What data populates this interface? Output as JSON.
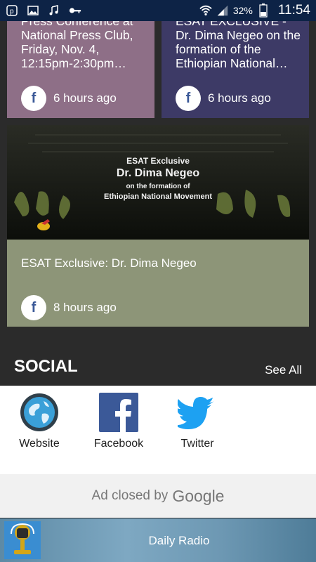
{
  "status_bar": {
    "battery_pct": "32%",
    "time": "11:54",
    "icons": [
      "p-app-icon",
      "image-icon",
      "music-note-icon",
      "key-icon",
      "wifi-icon",
      "signal-icon",
      "battery-icon"
    ]
  },
  "cards_top": [
    {
      "text": "Press Conference at National Press Club, Friday, Nov. 4, 12:15pm-2:30pm…",
      "time": "6 hours ago",
      "color": "#8e6f87"
    },
    {
      "text": "ESAT EXCLUSIVE - Dr. Dima Negeo on the formation of the Ethiopian National…",
      "time": "6 hours ago",
      "color": "#3d3a66"
    }
  ],
  "card_big": {
    "image_lines": [
      "ESAT Exclusive",
      "Dr. Dima Negeo",
      "on the formation of",
      "Ethiopian National Movement"
    ],
    "title": "ESAT Exclusive: Dr. Dima Negeo",
    "time": "8 hours ago",
    "color": "#8d9578"
  },
  "social": {
    "heading": "SOCIAL",
    "see_all": "See All",
    "items": [
      {
        "label": "Website",
        "icon": "globe-icon"
      },
      {
        "label": "Facebook",
        "icon": "facebook-icon"
      },
      {
        "label": "Twitter",
        "icon": "twitter-icon"
      }
    ]
  },
  "ad": {
    "text": "Ad closed by",
    "brand": "Google"
  },
  "player": {
    "title": "Daily Radio"
  },
  "colors": {
    "status_bar": "#0d2346",
    "background": "#2b2b2b",
    "facebook": "#3b5998",
    "twitter": "#1da1f2"
  }
}
